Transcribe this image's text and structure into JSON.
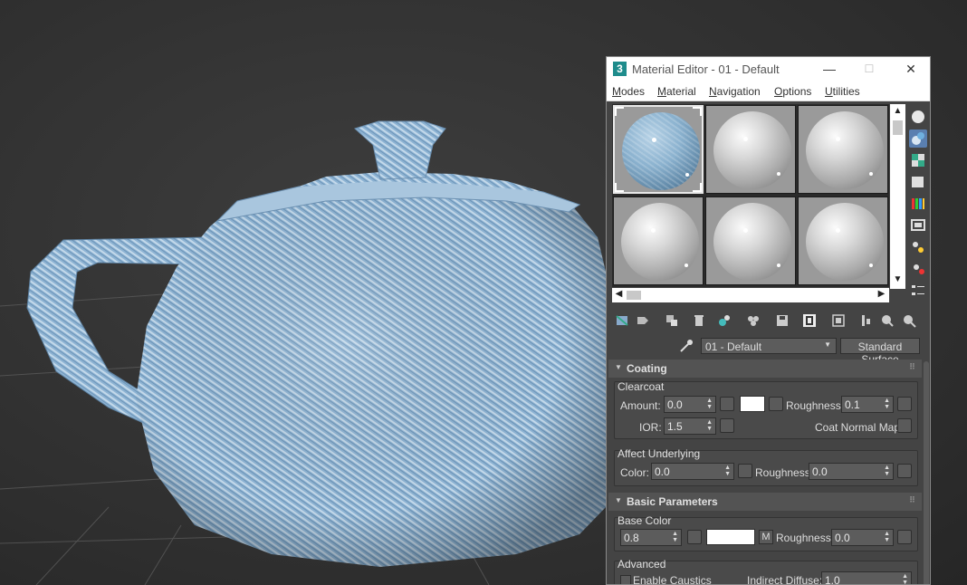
{
  "window": {
    "app_icon_text": "3",
    "title": "Material Editor - 01 - Default",
    "minimize": "—",
    "maximize": "☐",
    "close": "✕"
  },
  "menu": [
    "Modes",
    "Material",
    "Navigation",
    "Options",
    "Utilities"
  ],
  "material": {
    "name": "01 - Default",
    "type": "Standard Surface"
  },
  "coating": {
    "header": "Coating",
    "clearcoat_group": "Clearcoat",
    "amount_label": "Amount:",
    "amount_value": "0.0",
    "roughness_label": "Roughness:",
    "roughness_value": "0.1",
    "ior_label": "IOR:",
    "ior_value": "1.5",
    "coat_normal_label": "Coat Normal Map:",
    "affect_group": "Affect Underlying",
    "color_label": "Color:",
    "color_value": "0.0",
    "affect_roughness_label": "Roughness:",
    "affect_roughness_value": "0.0"
  },
  "basic": {
    "header": "Basic Parameters",
    "base_color_group": "Base Color",
    "base_weight_value": "0.8",
    "m_label": "M",
    "roughness_label": "Roughness:",
    "roughness_value": "0.0",
    "advanced_group": "Advanced",
    "caustics_label": "Enable Caustics",
    "indirect_label": "Indirect Diffuse:",
    "indirect_value": "1.0"
  },
  "colors": {
    "viewport_bg": "#2e2e2e",
    "grid": "#5a5a5a",
    "teapot": "#8fb4d4",
    "active_tool": "#5a7fb0"
  }
}
